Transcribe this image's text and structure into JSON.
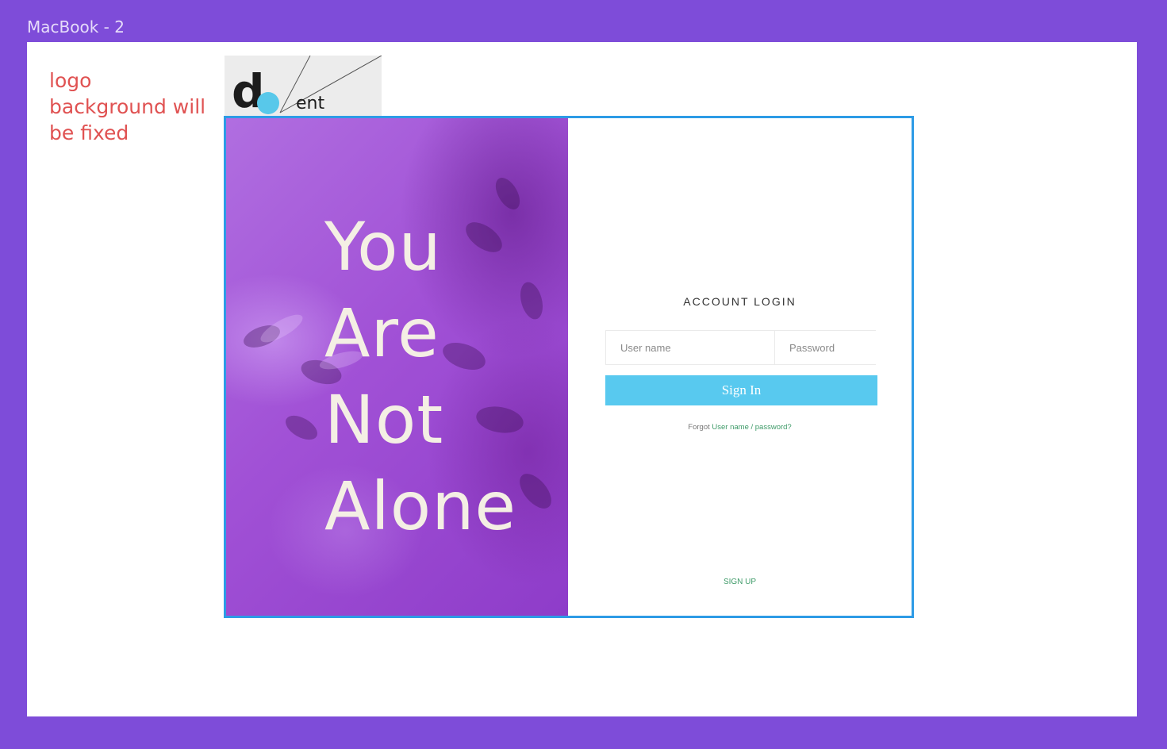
{
  "frame": {
    "title": "MacBook - 2"
  },
  "note": {
    "text": "logo background will be fixed"
  },
  "logo": {
    "letter": "d",
    "suffix": "ent"
  },
  "hero": {
    "lines": [
      "You",
      "Are",
      "Not",
      "Alone"
    ]
  },
  "login": {
    "title": "ACCOUNT LOGIN",
    "username_placeholder": "User name",
    "password_placeholder": "Password",
    "signin_label": "Sign In",
    "forgot_prefix": "Forgot",
    "forgot_link": "User name / password?",
    "signup_label": "SIGN UP"
  },
  "colors": {
    "canvas": "#7e4cd9",
    "note": "#e05252",
    "card_border": "#2d9be6",
    "button": "#58c9ef",
    "link": "#3f9b69",
    "hero_text": "#f4efe4"
  }
}
